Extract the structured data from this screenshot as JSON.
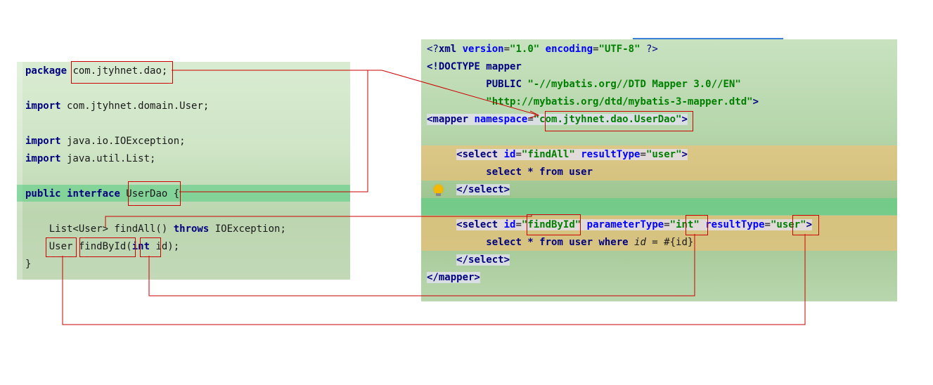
{
  "java_code": {
    "line1": {
      "kw": "package",
      "rest": " com.jtyhnet.dao;"
    },
    "line2": {
      "kw": "import",
      "rest": " com.jtyhnet.domain.User;"
    },
    "line3": {
      "kw": "import",
      "rest": " java.io.IOException;"
    },
    "line4": {
      "kw": "import",
      "rest": " java.util.List;"
    },
    "line5": {
      "kw1": "public",
      "kw2": "interface",
      "rest": " UserDao {"
    },
    "line6": {
      "pre": "    List<User> findAll() ",
      "kw": "throws",
      "rest": " IOException;"
    },
    "line7": {
      "pre": "    User findById(",
      "kw": "int",
      "rest": " id);"
    },
    "line8": {
      "text": "}"
    }
  },
  "xml_code": {
    "line1": {
      "a": "<?",
      "tag": "xml",
      "attr1": "version",
      "val1": "\"1.0\"",
      "attr2": "encoding",
      "val2": "\"UTF-8\"",
      "end": " ?>"
    },
    "line2": {
      "a": "<!",
      "tag": "DOCTYPE mapper"
    },
    "line3": {
      "kw": "PUBLIC",
      "val": "\"-//mybatis.org//DTD Mapper 3.0//EN\""
    },
    "line4": {
      "val": "\"http://mybatis.org/dtd/mybatis-3-mapper.dtd\"",
      "end": ">"
    },
    "line5": {
      "open": "<mapper",
      "attr": "namespace",
      "val": "\"com.jtyhnet.dao.UserDao\"",
      "end": ">"
    },
    "line6": {
      "open": "<select",
      "attr1": "id",
      "val1": "\"findAll\"",
      "attr2": "resultType",
      "val2": "\"user\"",
      "end": ">"
    },
    "line7": {
      "sql": "select * from user"
    },
    "line8": {
      "text": "</select>"
    },
    "line9": {
      "open": "<select",
      "attr1": "id",
      "val1": "\"findById\"",
      "attr2": "parameterType",
      "val2": "\"int\"",
      "attr3": "resultType",
      "val3": "\"user\"",
      "end": ">"
    },
    "line10": {
      "sql1": "select * from user where ",
      "param": "id",
      "sql2": " = #{id}"
    },
    "line11": {
      "text": "</select>"
    },
    "line12": {
      "text": "</mapper>"
    }
  },
  "colors": {
    "connector": "#cc0000",
    "keyword": "#000080",
    "string": "#008000",
    "attribute": "#0000ff"
  },
  "icons": {
    "intention": "lightbulb-icon"
  }
}
